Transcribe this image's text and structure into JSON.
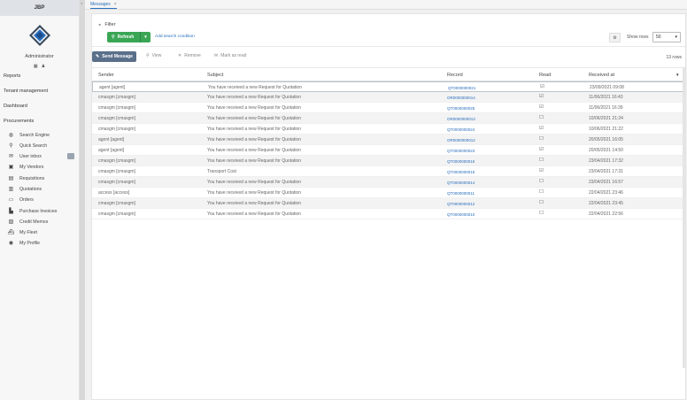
{
  "app": {
    "title": "JBP"
  },
  "user": {
    "name": "Administrator"
  },
  "sidebar": {
    "sections": [
      "Reports",
      "Tenant management",
      "Dashboard",
      "Procurements"
    ],
    "items": [
      {
        "label": "Search Engine",
        "icon": "globe-icon"
      },
      {
        "label": "Quick Search",
        "icon": "search-icon"
      },
      {
        "label": "User inbox",
        "icon": "envelope-icon"
      },
      {
        "label": "My Vendors",
        "icon": "vendor-icon"
      },
      {
        "label": "Requisitions",
        "icon": "requisition-icon"
      },
      {
        "label": "Quotations",
        "icon": "quotation-icon"
      },
      {
        "label": "Orders",
        "icon": "orders-icon"
      },
      {
        "label": "Purchase Invoices",
        "icon": "invoice-icon"
      },
      {
        "label": "Credit Memos",
        "icon": "credit-memo-icon"
      },
      {
        "label": "My Fleet",
        "icon": "ship-icon"
      },
      {
        "label": "My Profile",
        "icon": "profile-icon"
      }
    ]
  },
  "tabs": [
    {
      "label": "Messages",
      "close": "×"
    }
  ],
  "filter": {
    "label": "Filter",
    "refresh_label": "Refresh",
    "add_condition_label": "Add search condition",
    "show_rows_label": "Show rows",
    "rows_value": "50"
  },
  "toolbar": {
    "send_label": "Send Message",
    "view_label": "View",
    "remove_label": "Remove",
    "mark_read_label": "Mark as read",
    "count_label": "13 rows"
  },
  "table": {
    "columns": [
      "Sender",
      "Subject",
      "Record",
      "Read",
      "Received at"
    ],
    "rows": [
      {
        "sender": "agent [agent]",
        "subject": "You have received a new Request for Quotation",
        "record": "QT0000000021",
        "read": "☑",
        "received": "23/09/2021 09:08"
      },
      {
        "sender": "cmasgm [cmasgm]",
        "subject": "You have received a new Request for Quotation",
        "record": "OR0000000014",
        "read": "☑",
        "received": "11/06/2021 16:43"
      },
      {
        "sender": "cmasgm [cmasgm]",
        "subject": "You have received a new Request for Quotation",
        "record": "QT0000000025",
        "read": "☑",
        "received": "11/06/2021 16:39"
      },
      {
        "sender": "cmasgm [cmasgm]",
        "subject": "You have received a new Request for Quotation",
        "record": "OR0000000013",
        "read": "☐",
        "received": "10/06/2021 21:24"
      },
      {
        "sender": "cmasgm [cmasgm]",
        "subject": "You have received a new Request for Quotation",
        "record": "QT0000000024",
        "read": "☑",
        "received": "10/06/2021 21:22"
      },
      {
        "sender": "agent [agent]",
        "subject": "You have received a new Request for Quotation",
        "record": "OR0000000012",
        "read": "☐",
        "received": "20/05/2021 16:05"
      },
      {
        "sender": "agent [agent]",
        "subject": "You have received a new Request for Quotation",
        "record": "QT0000000023",
        "read": "☑",
        "received": "20/05/2021 14:50"
      },
      {
        "sender": "cmasgm [cmasgm]",
        "subject": "You have received a new Request for Quotation",
        "record": "QT0000000016",
        "read": "☐",
        "received": "23/04/2021 17:32"
      },
      {
        "sender": "cmasgm [cmasgm]",
        "subject": "Transport Cost",
        "record": "QT0000000015",
        "read": "☑",
        "received": "23/04/2021 17:31"
      },
      {
        "sender": "cmasgm [cmasgm]",
        "subject": "You have received a new Request for Quotation",
        "record": "QT0000000014",
        "read": "☐",
        "received": "23/04/2021 16:57"
      },
      {
        "sender": "access [access]",
        "subject": "You have received a new Request for Quotation",
        "record": "QT0000000011",
        "read": "☐",
        "received": "22/04/2021 23:46"
      },
      {
        "sender": "cmasgm [cmasgm]",
        "subject": "You have received a new Request for Quotation",
        "record": "QT0000000012",
        "read": "☐",
        "received": "22/04/2021 23:45"
      },
      {
        "sender": "cmasgm [cmasgm]",
        "subject": "You have received a new Request for Quotation",
        "record": "QT0000000010",
        "read": "☐",
        "received": "22/04/2021 22:56"
      }
    ]
  },
  "colors": {
    "accent": "#2a6ebd",
    "refresh": "#3aa655",
    "send": "#5a6f8a"
  }
}
